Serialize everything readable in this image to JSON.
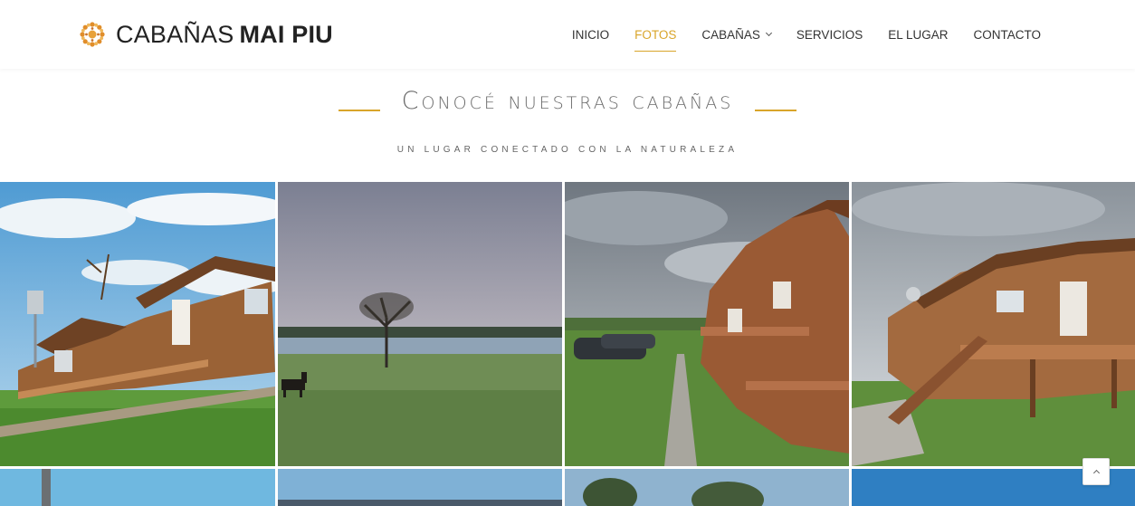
{
  "brand": {
    "name_light": "CABAÑAS",
    "name_bold": "MAI PIU",
    "accent": "#d9a52a"
  },
  "nav": {
    "items": [
      {
        "label": "INICIO"
      },
      {
        "label": "FOTOS",
        "active": true
      },
      {
        "label": "CABAÑAS",
        "dropdown": true
      },
      {
        "label": "SERVICIOS"
      },
      {
        "label": "EL LUGAR"
      },
      {
        "label": "CONTACTO"
      }
    ]
  },
  "section": {
    "title": "Conocé nuestras cabañas",
    "subtitle": "UN LUGAR CONECTADO CON LA NATURALEZA"
  },
  "gallery": {
    "photos": [
      {
        "subject": "log-cabins-blue-sky"
      },
      {
        "subject": "field-with-horse-and-tree"
      },
      {
        "subject": "row-of-cabins-with-path"
      },
      {
        "subject": "cabin-deck-closeup"
      },
      {
        "subject": "pole-sky"
      },
      {
        "subject": "horizon-water"
      },
      {
        "subject": "trees"
      },
      {
        "subject": "open-sky"
      }
    ]
  },
  "scroll_top": {
    "icon": "chevron-up-icon"
  }
}
